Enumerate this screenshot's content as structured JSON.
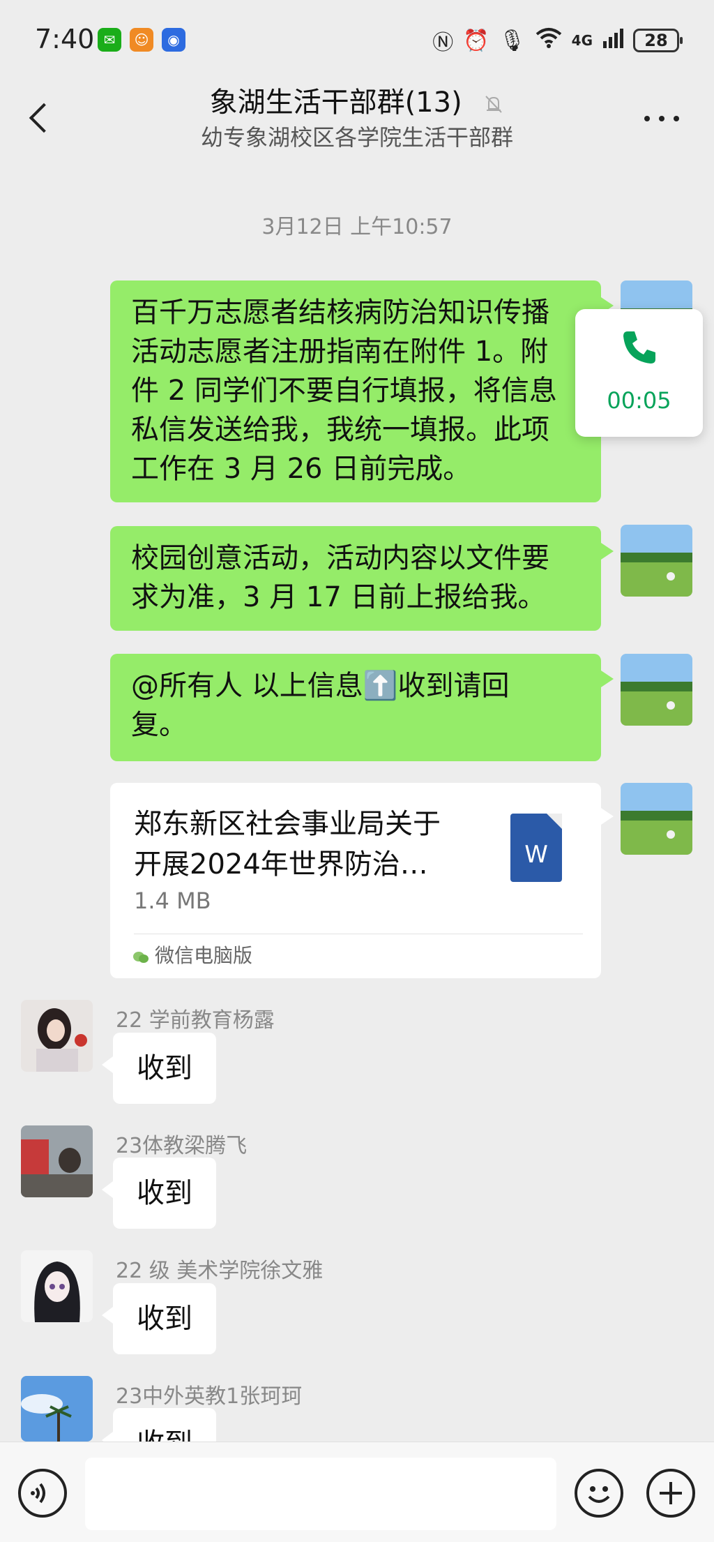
{
  "status_bar": {
    "time": "7:40",
    "network": "4G",
    "battery": "28",
    "notification_icons": [
      "wechat-icon",
      "chat-app-icon",
      "shield-app-icon"
    ]
  },
  "header": {
    "title": "象湖生活干部群(13)",
    "subtitle": "幼专象湖校区各学院生活干部群",
    "back_icon": "chevron-left-icon",
    "mute_icon": "bell-off-icon",
    "more_icon": "more-dots-icon"
  },
  "timestamp": "3月12日 上午10:57",
  "sent_messages": [
    {
      "lines": [
        "百千万志愿者结核病防治知识传播",
        "活动志愿者注册指南在附件 1。附",
        "件 2 同学们不要自行填报，将信息",
        "私信发送给我，我统一填报。此项",
        "工作在 3 月 26 日前完成。"
      ]
    },
    {
      "lines": [
        "校园创意活动，活动内容以文件要",
        "求为准，3 月 17 日前上报给我。"
      ]
    },
    {
      "lines": [
        "@所有人 以上信息⬆️收到请回",
        "复。"
      ]
    }
  ],
  "file_message": {
    "name_lines": [
      "郑东新区社会事业局关于",
      "开展2024年世界防治…"
    ],
    "size": "1.4 MB",
    "doc_letter": "W",
    "source": "微信电脑版"
  },
  "received_messages": [
    {
      "sender": "22 学前教育杨露",
      "text": "收到"
    },
    {
      "sender": "23体教梁腾飞",
      "text": "收到"
    },
    {
      "sender": "22 级 美术学院徐文雅",
      "text": "收到"
    },
    {
      "sender": "23中外英教1张珂珂",
      "text": "收到"
    }
  ],
  "call_overlay": {
    "duration": "00:05",
    "icon": "phone-icon"
  },
  "bottom_bar": {
    "voice_icon": "voice-icon",
    "emoji_icon": "emoji-icon",
    "add_icon": "plus-icon",
    "input_value": ""
  },
  "colors": {
    "sent_bubble": "#95ec69",
    "background": "#ededed",
    "call_green": "#07a35a",
    "doc_blue": "#2b5aa8"
  }
}
